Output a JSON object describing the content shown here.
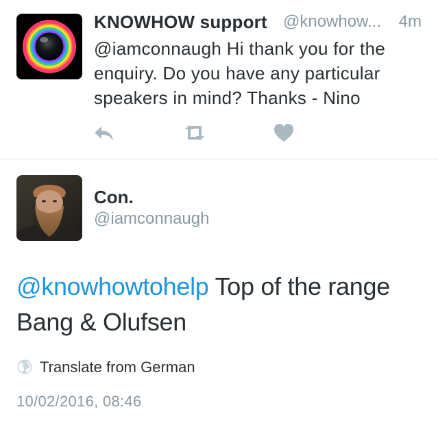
{
  "colors": {
    "text": "#292f33",
    "secondary": "#8899a6",
    "link": "#1b95e0",
    "divider": "#e1e8ed",
    "action_icon": "#aab8c2"
  },
  "reply_tweet": {
    "display_name": "KNOWHOW support",
    "handle": "@knowhow...",
    "time": "4m",
    "text": "@iamconnaugh Hi thank you for the enquiry. Do you have any particular speakers in mind? Thanks - Nino",
    "actions": {
      "reply_icon": "reply-arrow-icon",
      "retweet_icon": "retweet-icon",
      "like_icon": "heart-icon"
    },
    "avatar_icon": "camera-lens-rainbow-ring-logo"
  },
  "main_tweet": {
    "display_name": "Con.",
    "handle": "@iamconnaugh",
    "mention": "@knowhowtohelp",
    "text": " Top of the range Bang & Olufsen",
    "translate_label": "Translate from German",
    "translate_icon": "globe-icon",
    "timestamp": "10/02/2016, 08:46",
    "avatar_icon": "bearded-man-photo"
  }
}
